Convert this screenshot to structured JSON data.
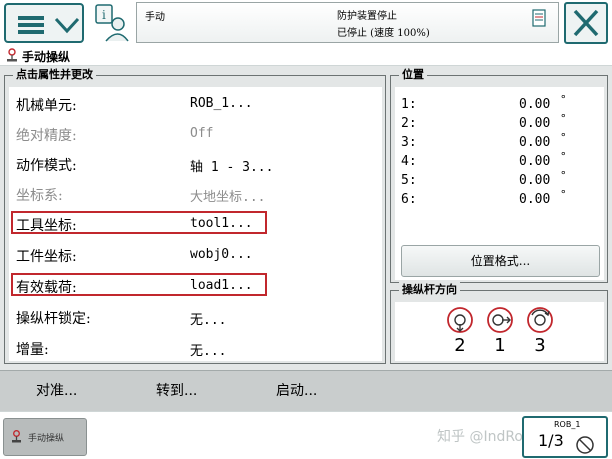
{
  "status": {
    "mode": "手动",
    "line1": "防护装置停止",
    "line2": "已停止 (速度 100%)"
  },
  "page": {
    "title": "手动操纵"
  },
  "properties": {
    "group_title": "点击属性并更改",
    "rows": [
      {
        "label": "机械单元:",
        "value": "ROB_1...",
        "disabled": false
      },
      {
        "label": "绝对精度:",
        "value": "Off",
        "disabled": true
      },
      {
        "label": "动作模式:",
        "value": "轴 1 - 3...",
        "disabled": false
      },
      {
        "label": "坐标系:",
        "value": "大地坐标...",
        "disabled": true
      },
      {
        "label": "工具坐标:",
        "value": "tool1...",
        "disabled": false
      },
      {
        "label": "工件坐标:",
        "value": "wobj0...",
        "disabled": false
      },
      {
        "label": "有效载荷:",
        "value": "load1...",
        "disabled": false
      },
      {
        "label": "操纵杆锁定:",
        "value": "无...",
        "disabled": false
      },
      {
        "label": "增量:",
        "value": "无...",
        "disabled": false
      }
    ]
  },
  "position": {
    "group_title": "位置",
    "rows": [
      {
        "index": "1:",
        "value": "0.00",
        "unit": "°"
      },
      {
        "index": "2:",
        "value": "0.00",
        "unit": "°"
      },
      {
        "index": "3:",
        "value": "0.00",
        "unit": "°"
      },
      {
        "index": "4:",
        "value": "0.00",
        "unit": "°"
      },
      {
        "index": "5:",
        "value": "0.00",
        "unit": "°"
      },
      {
        "index": "6:",
        "value": "0.00",
        "unit": "°"
      }
    ],
    "format_button": "位置格式..."
  },
  "joystick": {
    "group_title": "操纵杆方向",
    "axes": [
      "2",
      "1",
      "3"
    ]
  },
  "actions": {
    "align": "对准...",
    "goto": "转到...",
    "start": "启动..."
  },
  "taskbar": {
    "task_label": "手动操纵",
    "watermark": "知乎 @IndRobSim",
    "quickset_robot": "ROB_1",
    "quickset_fraction": "1/3"
  },
  "colors": {
    "accent": "#1f6a70",
    "highlight": "#c1272d",
    "panel_bg": "#e3e6e6"
  }
}
